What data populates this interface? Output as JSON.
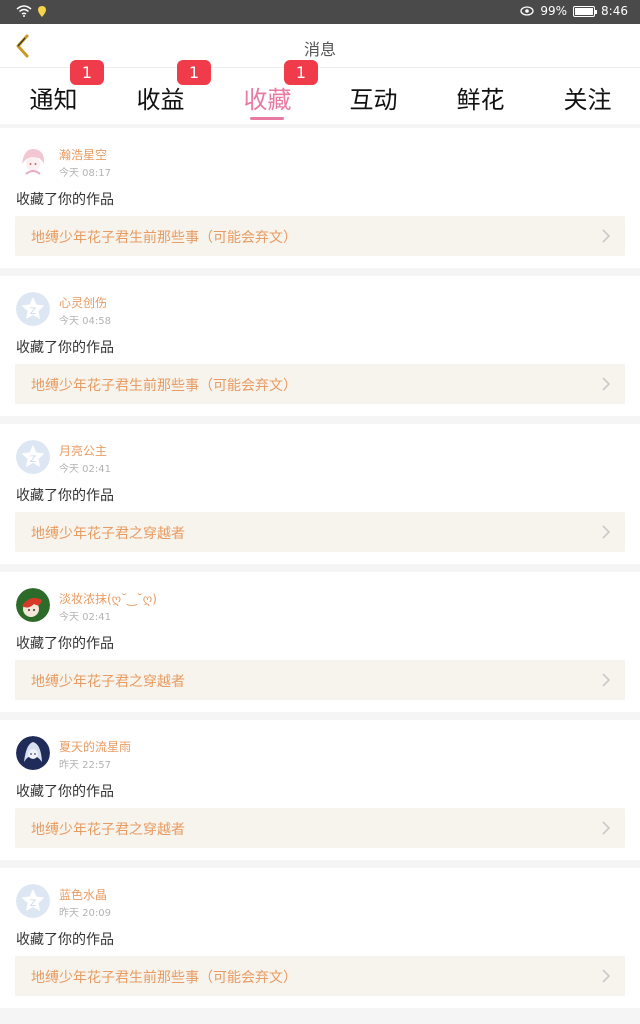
{
  "status_bar": {
    "battery": "99%",
    "time": "8:46",
    "battery_level": 0.99
  },
  "header": {
    "title": "消息"
  },
  "tabs": [
    {
      "label": "通知",
      "badge": "1",
      "active": false
    },
    {
      "label": "收益",
      "badge": "1",
      "active": false
    },
    {
      "label": "收藏",
      "badge": "1",
      "active": true
    },
    {
      "label": "互动",
      "badge": "",
      "active": false
    },
    {
      "label": "鲜花",
      "badge": "",
      "active": false
    },
    {
      "label": "关注",
      "badge": "",
      "active": false
    }
  ],
  "notifications": [
    {
      "username": "瀚浩星空",
      "time": "今天 08:17",
      "action": "收藏了你的作品",
      "work": "地缚少年花子君生前那些事（可能会弃文）",
      "avatar": "anime-avatar-pink"
    },
    {
      "username": "心灵创伤",
      "time": "今天 04:58",
      "action": "收藏了你的作品",
      "work": "地缚少年花子君生前那些事（可能会弃文）",
      "avatar": "default-star-avatar"
    },
    {
      "username": "月亮公主",
      "time": "今天 02:41",
      "action": "收藏了你的作品",
      "work": "地缚少年花子君之穿越者",
      "avatar": "default-star-avatar"
    },
    {
      "username": "淡妆浓抹(ღ˘‿˘ღ)",
      "time": "今天 02:41",
      "action": "收藏了你的作品",
      "work": "地缚少年花子君之穿越者",
      "avatar": "anime-avatar-green"
    },
    {
      "username": "夏天的流星雨",
      "time": "昨天 22:57",
      "action": "收藏了你的作品",
      "work": "地缚少年花子君之穿越者",
      "avatar": "anime-avatar-blue"
    },
    {
      "username": "蓝色水晶",
      "time": "昨天 20:09",
      "action": "收藏了你的作品",
      "work": "地缚少年花子君生前那些事（可能会弃文）",
      "avatar": "default-star-avatar"
    }
  ],
  "colors": {
    "accent": "#e97aa3",
    "badge": "#ef3b4a",
    "username": "#e89b63",
    "work_bg": "#f6f4ec"
  }
}
